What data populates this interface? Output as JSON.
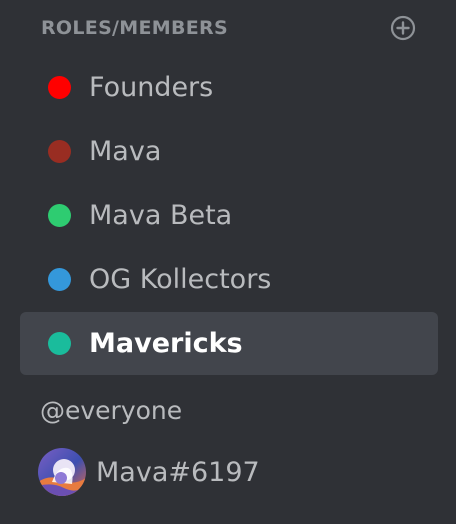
{
  "header": {
    "title": "ROLES/MEMBERS",
    "add_icon": "plus-circle-icon"
  },
  "roles": [
    {
      "label": "Founders",
      "color": "#ff0000",
      "selected": false
    },
    {
      "label": "Mava",
      "color": "#992d22",
      "selected": false
    },
    {
      "label": "Mava Beta",
      "color": "#2ecc71",
      "selected": false
    },
    {
      "label": "OG Kollectors",
      "color": "#3498db",
      "selected": false
    },
    {
      "label": "Mavericks",
      "color": "#1abc9c",
      "selected": true
    }
  ],
  "everyone": {
    "label": "@everyone"
  },
  "member": {
    "name": "Mava#6197",
    "avatar_icon": "user-avatar"
  },
  "colors": {
    "background": "#2f3136",
    "selected_background": "#42454c",
    "muted_text": "#b9bbbe",
    "header_text": "#8e9297"
  }
}
